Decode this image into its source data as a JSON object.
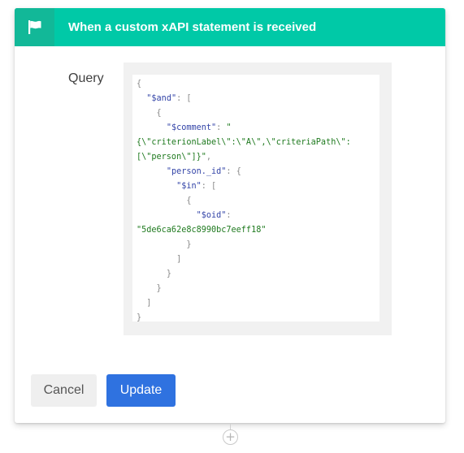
{
  "trigger": {
    "icon": "flag-icon",
    "title": "When a custom xAPI statement is received",
    "header_color": "#00c9a7",
    "icon_box_color": "#12b898"
  },
  "query": {
    "label": "Query",
    "lines": [
      [
        {
          "t": "punc",
          "v": "{"
        }
      ],
      [
        {
          "t": "ws",
          "v": "  "
        },
        {
          "t": "key",
          "v": "\"$and\""
        },
        {
          "t": "punc",
          "v": ": ["
        }
      ],
      [
        {
          "t": "ws",
          "v": "    "
        },
        {
          "t": "punc",
          "v": "{"
        }
      ],
      [
        {
          "t": "ws",
          "v": "      "
        },
        {
          "t": "key",
          "v": "\"$comment\""
        },
        {
          "t": "punc",
          "v": ": "
        },
        {
          "t": "str",
          "v": "\""
        }
      ],
      [
        {
          "t": "str",
          "v": "{\\\"criterionLabel\\\":\\\"A\\\",\\\"criteriaPath\\\":"
        }
      ],
      [
        {
          "t": "str",
          "v": "[\\\"person\\\"]}\""
        },
        {
          "t": "punc",
          "v": ","
        }
      ],
      [
        {
          "t": "ws",
          "v": "      "
        },
        {
          "t": "key",
          "v": "\"person._id\""
        },
        {
          "t": "punc",
          "v": ": {"
        }
      ],
      [
        {
          "t": "ws",
          "v": "        "
        },
        {
          "t": "key",
          "v": "\"$in\""
        },
        {
          "t": "punc",
          "v": ": ["
        }
      ],
      [
        {
          "t": "ws",
          "v": "          "
        },
        {
          "t": "punc",
          "v": "{"
        }
      ],
      [
        {
          "t": "ws",
          "v": "            "
        },
        {
          "t": "key",
          "v": "\"$oid\""
        },
        {
          "t": "punc",
          "v": ":"
        }
      ],
      [
        {
          "t": "str",
          "v": "\"5de6ca62e8c8990bc7eeff18\""
        }
      ],
      [
        {
          "t": "ws",
          "v": "          "
        },
        {
          "t": "punc",
          "v": "}"
        }
      ],
      [
        {
          "t": "ws",
          "v": "        "
        },
        {
          "t": "punc",
          "v": "]"
        }
      ],
      [
        {
          "t": "ws",
          "v": "      "
        },
        {
          "t": "punc",
          "v": "}"
        }
      ],
      [
        {
          "t": "ws",
          "v": "    "
        },
        {
          "t": "punc",
          "v": "}"
        }
      ],
      [
        {
          "t": "ws",
          "v": "  "
        },
        {
          "t": "punc",
          "v": "]"
        }
      ],
      [
        {
          "t": "punc",
          "v": "}"
        }
      ]
    ]
  },
  "actions": {
    "cancel_label": "Cancel",
    "update_label": "Update",
    "update_color": "#2f72e0"
  },
  "add_step": {
    "icon": "plus-icon",
    "glyph": "+"
  }
}
